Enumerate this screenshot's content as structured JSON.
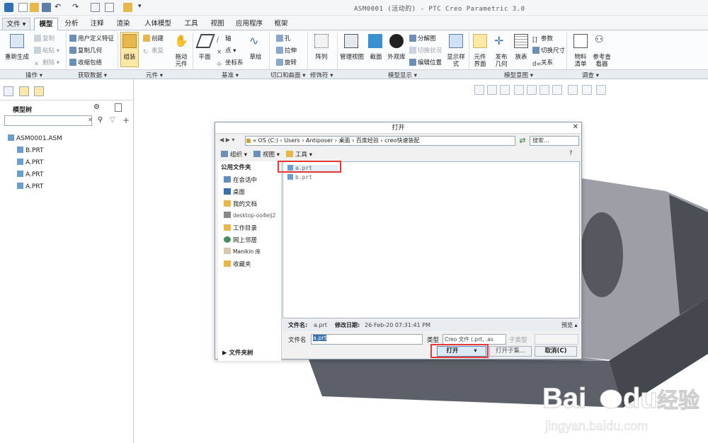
{
  "app": {
    "title": "ASM0001 (活动的) - PTC Creo Parametric 3.0"
  },
  "quick_access": {
    "icons": [
      "app-logo-icon",
      "new-file-icon",
      "open-file-icon",
      "save-icon",
      "undo-icon",
      "redo-icon",
      "regenerate-icon",
      "window-icon",
      "close-window-icon",
      "customize-icon"
    ]
  },
  "tabs": [
    "文件 ▾",
    "模型",
    "分析",
    "注释",
    "渲染",
    "人体模型",
    "工具",
    "视图",
    "应用程序",
    "框架"
  ],
  "ribbon": {
    "regen": "重新生成",
    "copy": "复制",
    "paste": "粘贴 ▾",
    "delete": "删除 ▾",
    "user_feature": "用户定义特征",
    "copy_geom": "复制几何",
    "shrinkwrap": "收缩包络",
    "assemble": "组装",
    "create": "创建",
    "repeat": "重复",
    "drag": "拖动\n元件",
    "plane": "平面",
    "axis": "轴",
    "point": "点 ▾",
    "csys": "坐标系",
    "sketch": "草绘",
    "hole": "孔",
    "extrude": "拉伸",
    "revolve": "旋转",
    "pattern": "阵列",
    "manage_views": "管理视图",
    "section": "截面",
    "appearance": "外观库",
    "explode": "分解图",
    "toggle_status": "切换状况",
    "edit_position": "编辑位置",
    "display_style": "显示样\n式",
    "comp_interface": "元件\n界面",
    "publish_geom": "发布\n几何",
    "family_table": "族表",
    "parameters": "参数",
    "toggle_dims": "切换尺寸",
    "relations": "关系",
    "bom": "物料\n清单",
    "ref_viewer": "参考查\n看器"
  },
  "ribbon_groups": [
    "操作 ▾",
    "获取数据 ▾",
    "元件 ▾",
    "基准 ▾",
    "切口和曲面 ▾",
    "修饰符 ▾",
    "模型显示 ▾",
    "模型意图 ▾",
    "调查 ▾"
  ],
  "model_tree": {
    "title": "模型树",
    "items": [
      "ASM0001.ASM",
      "B.PRT",
      "A.PRT",
      "A.PRT",
      "A.PRT"
    ]
  },
  "dialog": {
    "title": "打开",
    "path": [
      "OS (C:)",
      "Users",
      "Antiposer",
      "桌面",
      "百度经验",
      "creo快速装配"
    ],
    "search_placeholder": "搜索...",
    "organize": "组织",
    "views": "视图",
    "tools": "工具",
    "common_folders": "公用文件夹",
    "sidebar_items": [
      "在会话中",
      "桌面",
      "我的文档",
      "desktop-oo4eij2",
      "工作目录",
      "网上邻居",
      "Manikin 库",
      "收藏夹"
    ],
    "files": [
      "a.prt",
      "b.prt"
    ],
    "info_name_label": "文件名:",
    "info_name_value": "a.prt",
    "info_date_label": "修改日期:",
    "info_date_value": "26-Feb-20 07:31:41 PM",
    "preview": "预览 ▴",
    "filename_label": "文件名",
    "filename_value": "a.prt",
    "type_label": "类型",
    "type_value": "Creo 文件 (.prt, .as",
    "subtype_label": "子类型",
    "folder_tree": "文件夹树",
    "open_btn": "打开",
    "open_subset": "打开子集...",
    "cancel": "取消(C)"
  },
  "watermark": {
    "brand_a": "Bai",
    "brand_b": "du",
    "brand_cn": "经验",
    "url": "jingyan.baidu.com"
  }
}
